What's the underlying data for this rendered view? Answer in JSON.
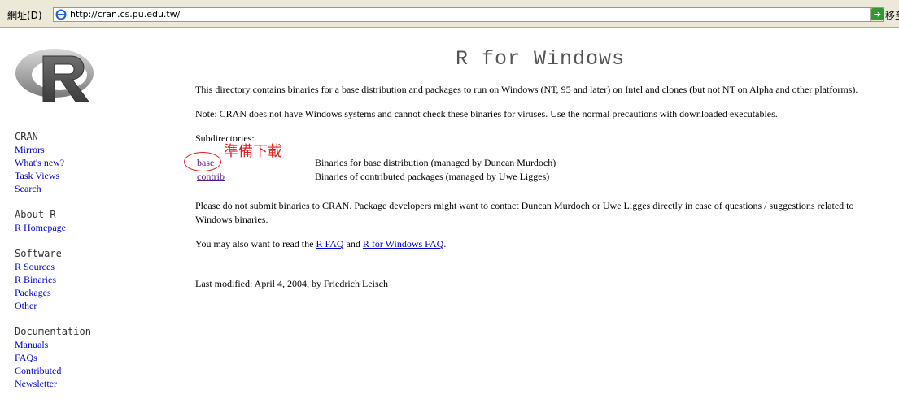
{
  "address_bar": {
    "label": "網址(D)",
    "url": "http://cran.cs.pu.edu.tw/",
    "go_label": "移至"
  },
  "sidebar": {
    "groups": [
      {
        "heading": "CRAN",
        "items": [
          "Mirrors",
          "What's new?",
          "Task Views",
          "Search"
        ]
      },
      {
        "heading": "About R",
        "items": [
          "R Homepage"
        ]
      },
      {
        "heading": "Software",
        "items": [
          "R Sources",
          "R Binaries",
          "Packages",
          "Other"
        ]
      },
      {
        "heading": "Documentation",
        "items": [
          "Manuals",
          "FAQs",
          "Contributed",
          "Newsletter"
        ]
      }
    ]
  },
  "main": {
    "title": "R for Windows",
    "para1": "This directory contains binaries for a base distribution and packages to run on Windows (NT, 95 and later) on Intel and clones (but not NT on Alpha and other platforms).",
    "note": "Note: CRAN does not have Windows systems and cannot check these binaries for viruses. Use the normal precautions with downloaded executables.",
    "subdirs_label": "Subdirectories:",
    "subdirs": [
      {
        "name": "base",
        "desc": "Binaries for base distribution (managed by Duncan Murdoch)"
      },
      {
        "name": "contrib",
        "desc": "Binaries of contributed packages (managed by Uwe Ligges)"
      }
    ],
    "annotation": "準備下載",
    "para2": "Please do not submit binaries to CRAN. Package developers might want to contact Duncan Murdoch or Uwe Ligges directly in case of questions / suggestions related to Windows binaries.",
    "faq_prefix": "You may also want to read the ",
    "faq_link1": "R FAQ",
    "faq_mid": " and ",
    "faq_link2": "R for Windows FAQ",
    "faq_suffix": ".",
    "last_modified": "Last modified: April 4, 2004, by Friedrich Leisch"
  },
  "colors": {
    "link": "#0000cc",
    "visited": "#551a8b",
    "annotation": "#e02020",
    "title": "#555555"
  }
}
